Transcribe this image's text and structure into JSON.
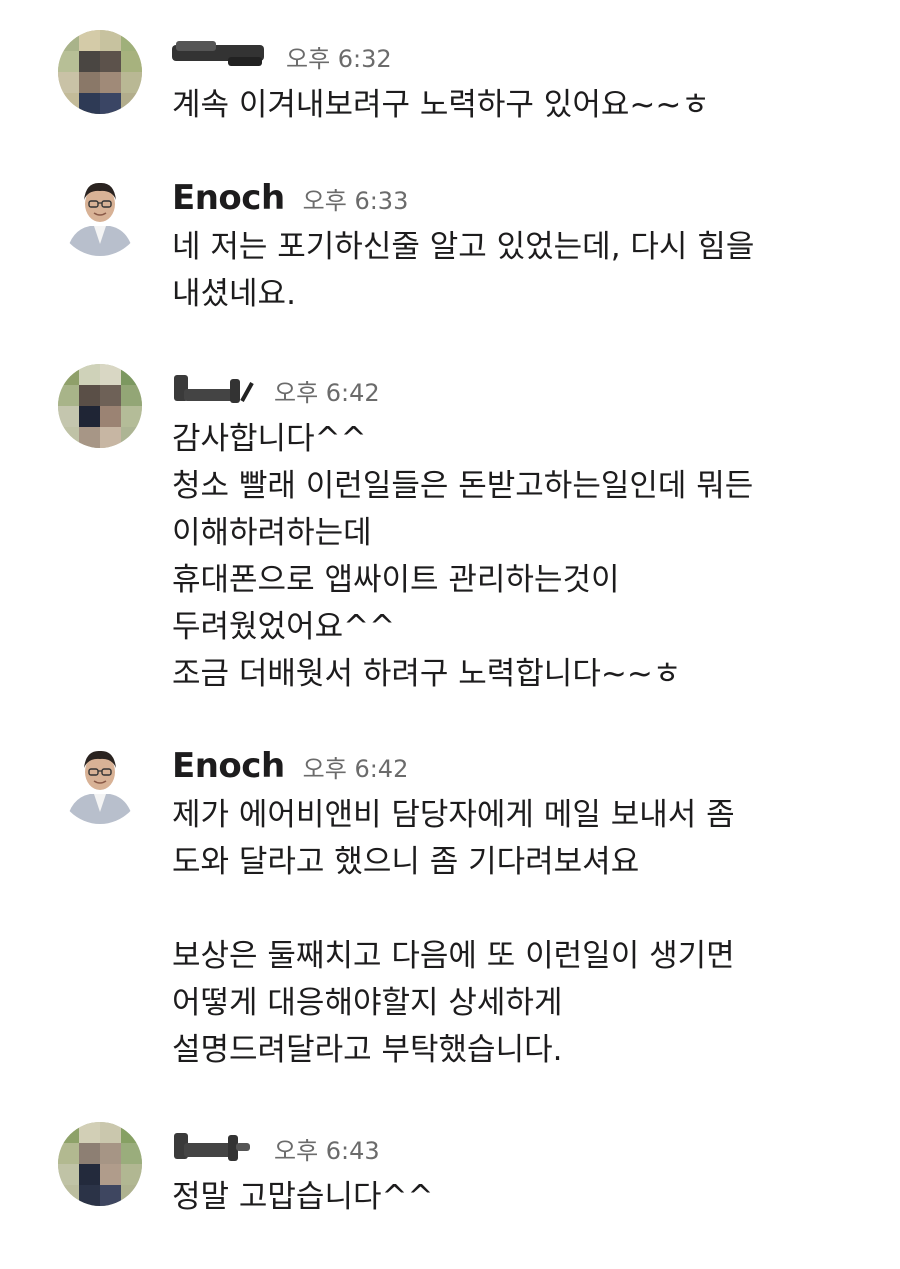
{
  "messages": [
    {
      "sender": "",
      "time": "오후 6:32",
      "avatar_icon": "blurred-user-avatar",
      "lines": [
        "계속 이겨내보려구 노력하구 있어요~~ㅎ"
      ]
    },
    {
      "sender": "Enoch",
      "time": "오후 6:33",
      "avatar_icon": "enoch-avatar",
      "lines": [
        "네 저는 포기하신줄 알고 있었는데, 다시 힘을",
        "내셨네요."
      ]
    },
    {
      "sender": "",
      "time": "오후 6:42",
      "avatar_icon": "blurred-user-avatar",
      "lines": [
        "감사합니다^^",
        "청소 빨래 이런일들은 돈받고하는일인데 뭐든",
        "이해하려하는데",
        "휴대폰으로 앱싸이트 관리하는것이",
        "두려웠었어요^^",
        "조금 더배웟서 하려구 노력합니다~~ㅎ"
      ]
    },
    {
      "sender": "Enoch",
      "time": "오후 6:42",
      "avatar_icon": "enoch-avatar",
      "lines": [
        "제가 에어비앤비 담당자에게 메일 보내서 좀",
        "도와 달라고 했으니 좀 기다려보셔요",
        "",
        "보상은 둘째치고 다음에 또 이런일이 생기면",
        "어떻게 대응해야할지 상세하게",
        "설명드려달라고 부탁했습니다."
      ]
    },
    {
      "sender": "",
      "time": "오후 6:43",
      "avatar_icon": "blurred-user-avatar",
      "lines": [
        "정말 고맙습니다^^"
      ]
    }
  ]
}
